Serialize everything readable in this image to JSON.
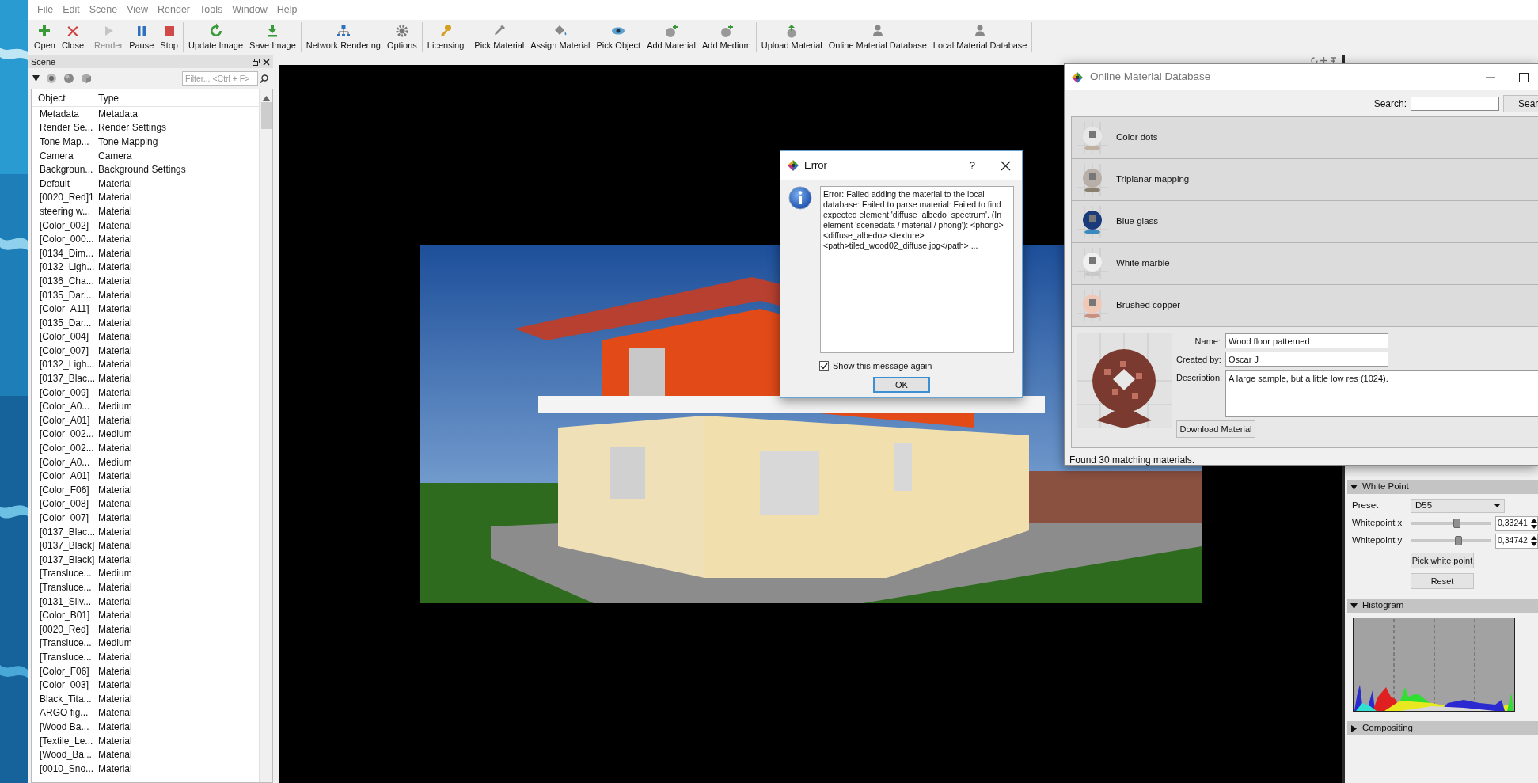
{
  "menu": [
    "File",
    "Edit",
    "Scene",
    "View",
    "Render",
    "Tools",
    "Window",
    "Help"
  ],
  "toolbar": [
    {
      "buttons": [
        {
          "label": "Open",
          "kind": "add",
          "disabled": false
        },
        {
          "label": "Close",
          "kind": "close",
          "disabled": false
        }
      ]
    },
    {
      "buttons": [
        {
          "label": "Render",
          "kind": "play",
          "disabled": true
        },
        {
          "label": "Pause",
          "kind": "pause",
          "disabled": false
        },
        {
          "label": "Stop",
          "kind": "stop",
          "disabled": false
        }
      ]
    },
    {
      "buttons": [
        {
          "label": "Update Image",
          "kind": "refresh",
          "disabled": false
        },
        {
          "label": "Save Image",
          "kind": "save",
          "disabled": false
        }
      ]
    },
    {
      "buttons": [
        {
          "label": "Network Rendering",
          "kind": "network",
          "disabled": false
        },
        {
          "label": "Options",
          "kind": "gear",
          "disabled": false
        }
      ]
    },
    {
      "buttons": [
        {
          "label": "Licensing",
          "kind": "key",
          "disabled": false
        }
      ]
    },
    {
      "buttons": [
        {
          "label": "Pick Material",
          "kind": "dropper",
          "disabled": false
        },
        {
          "label": "Assign Material",
          "kind": "bucket",
          "disabled": false
        },
        {
          "label": "Pick Object",
          "kind": "eye",
          "disabled": false
        },
        {
          "label": "Add Material",
          "kind": "sphere_add",
          "disabled": false
        },
        {
          "label": "Add Medium",
          "kind": "sphere_add",
          "disabled": false
        }
      ]
    },
    {
      "buttons": [
        {
          "label": "Upload Material",
          "kind": "upload",
          "disabled": false
        },
        {
          "label": "Online Material Database",
          "kind": "person",
          "disabled": false
        },
        {
          "label": "Local Material Database",
          "kind": "person",
          "disabled": false
        }
      ]
    }
  ],
  "scene": {
    "title": "Scene",
    "filter": {
      "placeholder": "Filter... <Ctrl + F>"
    },
    "columns": [
      "Object",
      "Type"
    ],
    "rows": [
      {
        "object": "Metadata",
        "type": "Metadata"
      },
      {
        "object": "Render Se...",
        "type": "Render Settings"
      },
      {
        "object": "Tone Map...",
        "type": "Tone Mapping"
      },
      {
        "object": "Camera",
        "type": "Camera"
      },
      {
        "object": "Backgroun...",
        "type": "Background Settings"
      },
      {
        "object": "Default",
        "type": "Material"
      },
      {
        "object": "[0020_Red]1",
        "type": "Material"
      },
      {
        "object": "steering w...",
        "type": "Material"
      },
      {
        "object": "[Color_002]",
        "type": "Material"
      },
      {
        "object": "[Color_000...",
        "type": "Material"
      },
      {
        "object": "[0134_Dim...",
        "type": "Material"
      },
      {
        "object": "[0132_Ligh...",
        "type": "Material"
      },
      {
        "object": "[0136_Cha...",
        "type": "Material"
      },
      {
        "object": "[0135_Dar...",
        "type": "Material"
      },
      {
        "object": "[Color_A11]",
        "type": "Material"
      },
      {
        "object": "[0135_Dar...",
        "type": "Material"
      },
      {
        "object": "[Color_004]",
        "type": "Material"
      },
      {
        "object": "[Color_007]",
        "type": "Material"
      },
      {
        "object": "[0132_Ligh...",
        "type": "Material"
      },
      {
        "object": "[0137_Blac...",
        "type": "Material"
      },
      {
        "object": "[Color_009]",
        "type": "Material"
      },
      {
        "object": "[Color_A0...",
        "type": "Medium"
      },
      {
        "object": "[Color_A01]",
        "type": "Material"
      },
      {
        "object": "[Color_002...",
        "type": "Medium"
      },
      {
        "object": "[Color_002...",
        "type": "Material"
      },
      {
        "object": "[Color_A0...",
        "type": "Medium"
      },
      {
        "object": "[Color_A01]",
        "type": "Material"
      },
      {
        "object": "[Color_F06]",
        "type": "Material"
      },
      {
        "object": "[Color_008]",
        "type": "Material"
      },
      {
        "object": "[Color_007]",
        "type": "Material"
      },
      {
        "object": "[0137_Blac...",
        "type": "Material"
      },
      {
        "object": "[0137_Black]",
        "type": "Material"
      },
      {
        "object": "[0137_Black]",
        "type": "Material"
      },
      {
        "object": "[Transluce...",
        "type": "Medium"
      },
      {
        "object": "[Transluce...",
        "type": "Material"
      },
      {
        "object": "[0131_Silv...",
        "type": "Material"
      },
      {
        "object": "[Color_B01]",
        "type": "Material"
      },
      {
        "object": "[0020_Red]",
        "type": "Material"
      },
      {
        "object": "[Transluce...",
        "type": "Medium"
      },
      {
        "object": "[Transluce...",
        "type": "Material"
      },
      {
        "object": "[Color_F06]",
        "type": "Material"
      },
      {
        "object": "[Color_003]",
        "type": "Material"
      },
      {
        "object": "Black_Tita...",
        "type": "Material"
      },
      {
        "object": "ARGO fig...",
        "type": "Material"
      },
      {
        "object": "[Wood Ba...",
        "type": "Material"
      },
      {
        "object": "[Textile_Le...",
        "type": "Material"
      },
      {
        "object": "[Wood_Ba...",
        "type": "Material"
      },
      {
        "object": "[0010_Sno...",
        "type": "Material"
      }
    ]
  },
  "error_dialog": {
    "title": "Error",
    "help": "?",
    "message": "Error: Failed adding the material to the local database: Failed to parse material: Failed to find expected element 'diffuse_albedo_spectrum'. (In element 'scenedata / material / phong'): <phong> <diffuse_albedo> <texture> <path>tiled_wood02_diffuse.jpg</path> ...",
    "checkbox": {
      "label": "Show this message again",
      "checked": true
    },
    "button": "OK"
  },
  "material_db": {
    "title": "Online Material Database",
    "search_label": "Search:",
    "search_button": "Sear",
    "materials": [
      {
        "name": "Color dots"
      },
      {
        "name": "Triplanar mapping"
      },
      {
        "name": "Blue glass"
      },
      {
        "name": "White marble"
      },
      {
        "name": "Brushed copper"
      }
    ],
    "details": {
      "name_label": "Name:",
      "name": "Wood floor patterned",
      "creator_label": "Created by:",
      "creator": "Oscar J",
      "description_label": "Description:",
      "description": "A large sample, but a little low res (1024).",
      "button": "Download Material"
    },
    "status": "Found 30 matching materials."
  },
  "white_point": {
    "title": "White Point",
    "expanded": true,
    "preset_label": "Preset",
    "preset": "D55",
    "sliders": [
      {
        "label": "Whitepoint x",
        "level": 0.57,
        "value": "0,33241"
      },
      {
        "label": "Whitepoint y",
        "level": 0.59,
        "value": "0,34742"
      }
    ],
    "buttons": [
      "Pick white point",
      "Reset"
    ]
  },
  "histogram": {
    "title": "Histogram",
    "expanded": true
  },
  "compositing": {
    "title": "Compositing",
    "expanded": false
  }
}
